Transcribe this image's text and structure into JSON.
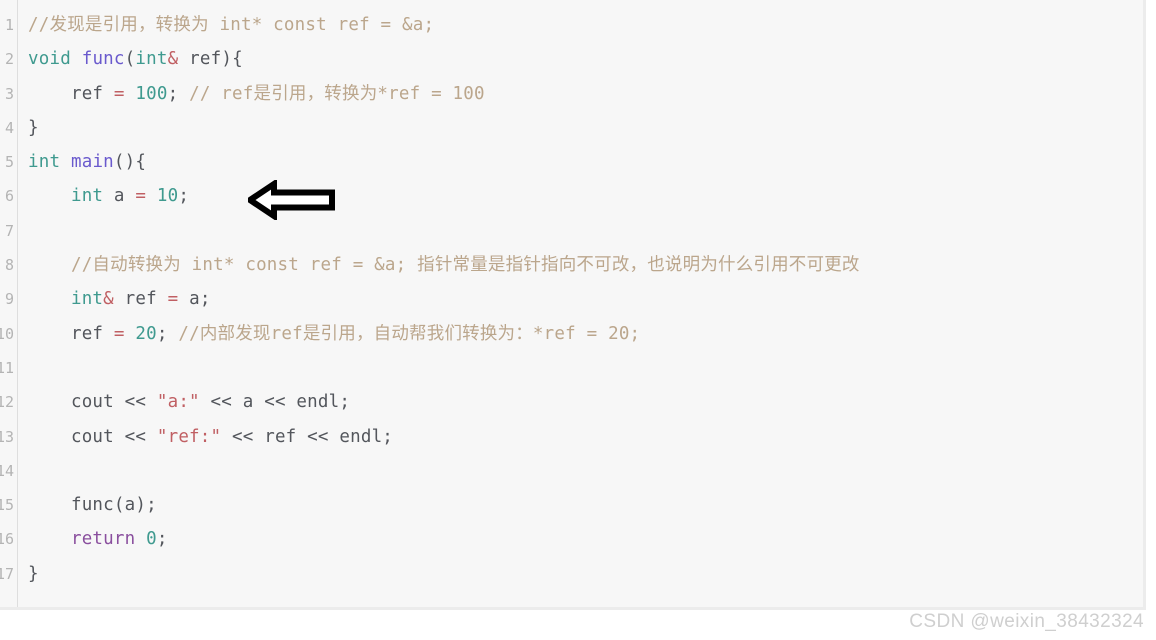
{
  "editor": {
    "title": "cpp-reference-code-snippet",
    "language": "cpp",
    "background_color": "#f7f7f7",
    "gutter_border_color": "#dedede",
    "comment_color": "#bba68c",
    "keyword_color": "#3f9a8f",
    "function_color": "#6a5acd",
    "control_color": "#8a4f9e",
    "string_color": "#c05f63",
    "line_numbers": [
      "1",
      "2",
      "3",
      "4",
      "5",
      "6",
      "7",
      "8",
      "9",
      "10",
      "11",
      "12",
      "13",
      "14",
      "15",
      "16",
      "17"
    ],
    "lines": [
      {
        "number": "1",
        "text": "//发现是引用，转换为 int* const ref = &a;"
      },
      {
        "number": "2",
        "text": "void func(int& ref){"
      },
      {
        "number": "3",
        "text": "    ref = 100; // ref是引用，转换为*ref = 100"
      },
      {
        "number": "4",
        "text": "}"
      },
      {
        "number": "5",
        "text": "int main(){"
      },
      {
        "number": "6",
        "text": "    int a = 10;"
      },
      {
        "number": "7",
        "text": ""
      },
      {
        "number": "8",
        "text": "    //自动转换为 int* const ref = &a; 指针常量是指针指向不可改，也说明为什么引用不可更改"
      },
      {
        "number": "9",
        "text": "    int& ref = a;"
      },
      {
        "number": "10",
        "text": "    ref = 20; //内部发现ref是引用，自动帮我们转换为：*ref = 20;"
      },
      {
        "number": "11",
        "text": ""
      },
      {
        "number": "12",
        "text": "    cout << \"a:\" << a << endl;"
      },
      {
        "number": "13",
        "text": "    cout << \"ref:\" << ref << endl;"
      },
      {
        "number": "14",
        "text": ""
      },
      {
        "number": "15",
        "text": "    func(a);"
      },
      {
        "number": "16",
        "text": "    return 0;"
      },
      {
        "number": "17",
        "text": "}"
      }
    ],
    "tokens": {
      "l1_comment": "//发现是引用，转换为 int* const ref = &a;",
      "l2_void": "void",
      "l2_space1": " ",
      "l2_func": "func",
      "l2_open": "(",
      "l2_int": "int",
      "l2_amp": "&",
      "l2_ref": " ref",
      "l2_close": "){",
      "l3_indent": "    ",
      "l3_ref": "ref ",
      "l3_eq": "=",
      "l3_val": " 100",
      "l3_semi": "; ",
      "l3_comment": "// ref是引用，转换为*ref = 100",
      "l4_brace": "}",
      "l5_int": "int",
      "l5_space": " ",
      "l5_main": "main",
      "l5_rest": "(){",
      "l6_indent": "    ",
      "l6_int": "int",
      "l6_a": " a ",
      "l6_eq": "=",
      "l6_val": " 10",
      "l6_semi": ";",
      "l8_indent": "    ",
      "l8_comment": "//自动转换为 int* const ref = &a; 指针常量是指针指向不可改，也说明为什么引用不可更改",
      "l9_indent": "    ",
      "l9_int": "int",
      "l9_amp": "&",
      "l9_ref": " ref ",
      "l9_eq": "=",
      "l9_a": " a;",
      "l10_indent": "    ",
      "l10_ref": "ref ",
      "l10_eq": "=",
      "l10_val": " 20",
      "l10_semi": "; ",
      "l10_comment": "//内部发现ref是引用，自动帮我们转换为：*ref = 20;",
      "l12_indent": "    ",
      "l12_cout": "cout << ",
      "l12_str": "\"a:\"",
      "l12_rest": " << a << endl;",
      "l13_indent": "    ",
      "l13_cout": "cout << ",
      "l13_str": "\"ref:\"",
      "l13_rest": " << ref << endl;",
      "l15_indent": "    ",
      "l15_call": "func(a);",
      "l16_indent": "    ",
      "l16_return": "return",
      "l16_val": " 0",
      "l16_semi": ";",
      "l17_brace": "}"
    }
  },
  "annotation": {
    "arrow_name": "left-pointing-block-arrow",
    "points_to_line": "6",
    "points_to_code": "int a = 10;",
    "fill_color": "#ffffff",
    "outline_color": "#000000"
  },
  "watermark": {
    "text": "CSDN @weixin_38432324",
    "color": "#cfcfcf"
  }
}
